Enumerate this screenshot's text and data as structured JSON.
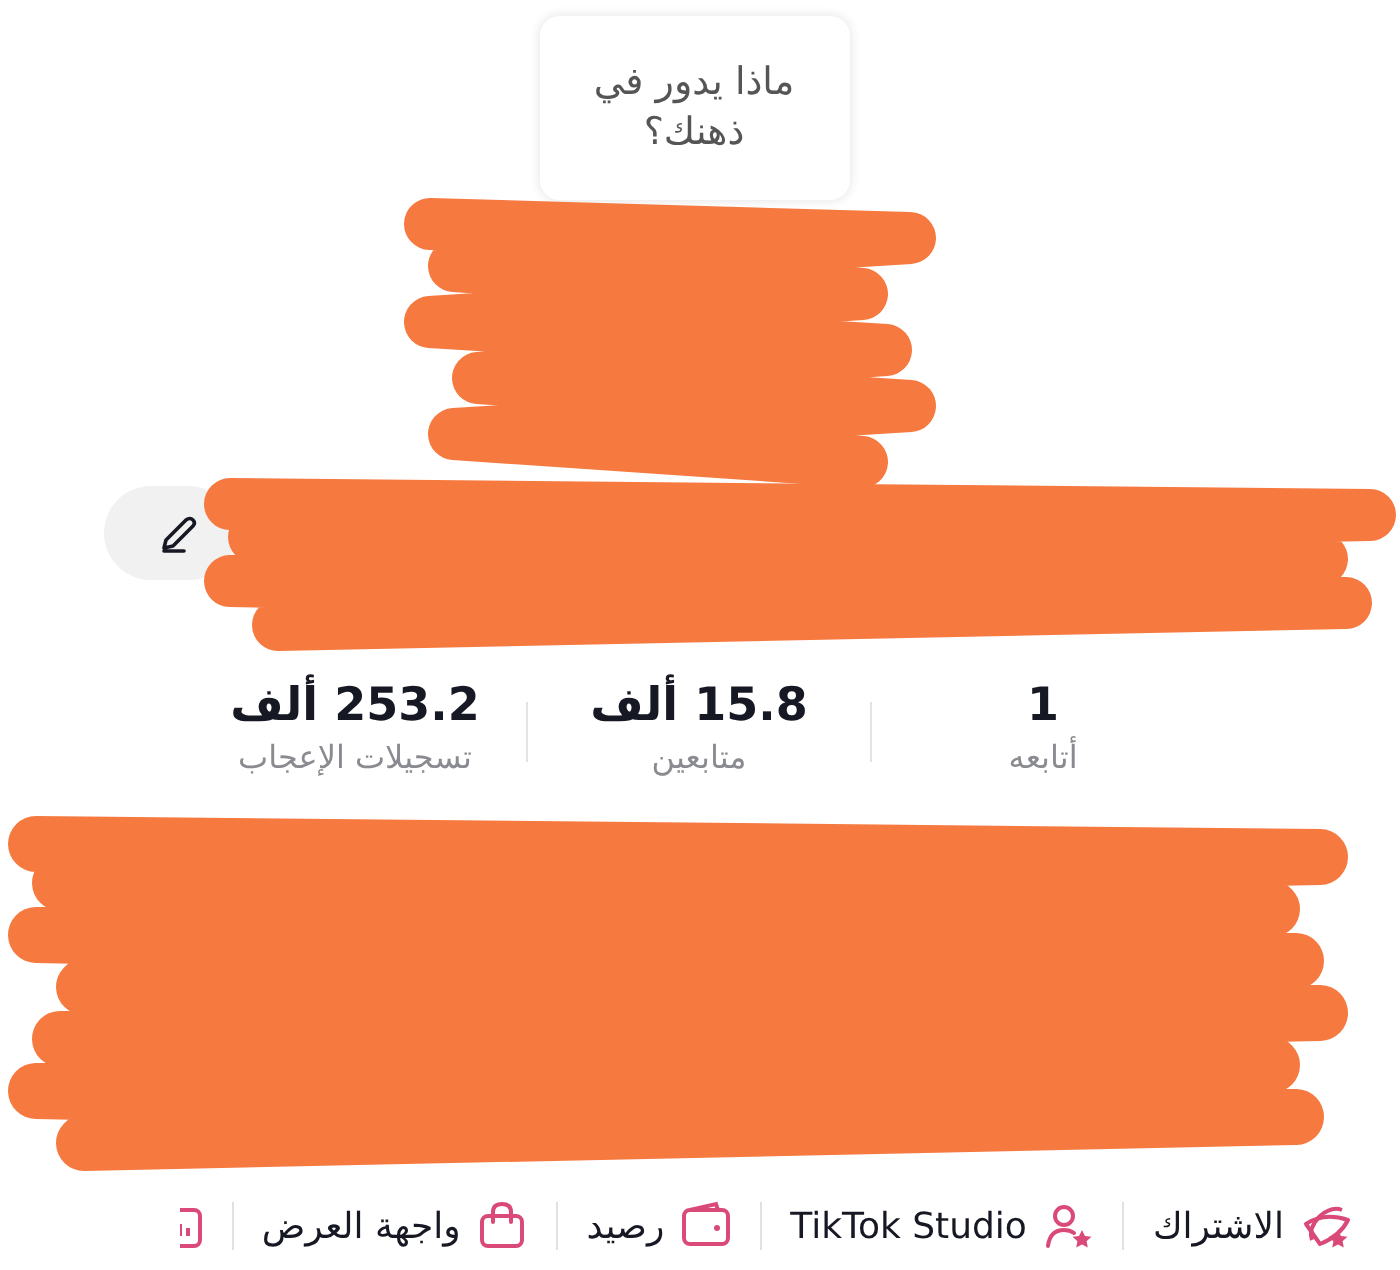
{
  "prompt_bubble": {
    "text": "ماذا يدور في ذهنك؟"
  },
  "stats": [
    {
      "value": "1",
      "label": "أتابعه"
    },
    {
      "value": "15.8 ألف",
      "label": "متابعين"
    },
    {
      "value": "253.2 ألف",
      "label": "تسجيلات الإعجاب"
    }
  ],
  "shortcuts": [
    {
      "label": "الاشتراك"
    },
    {
      "label": "TikTok Studio"
    },
    {
      "label": "رصيد"
    },
    {
      "label": "واجهة العرض"
    }
  ]
}
